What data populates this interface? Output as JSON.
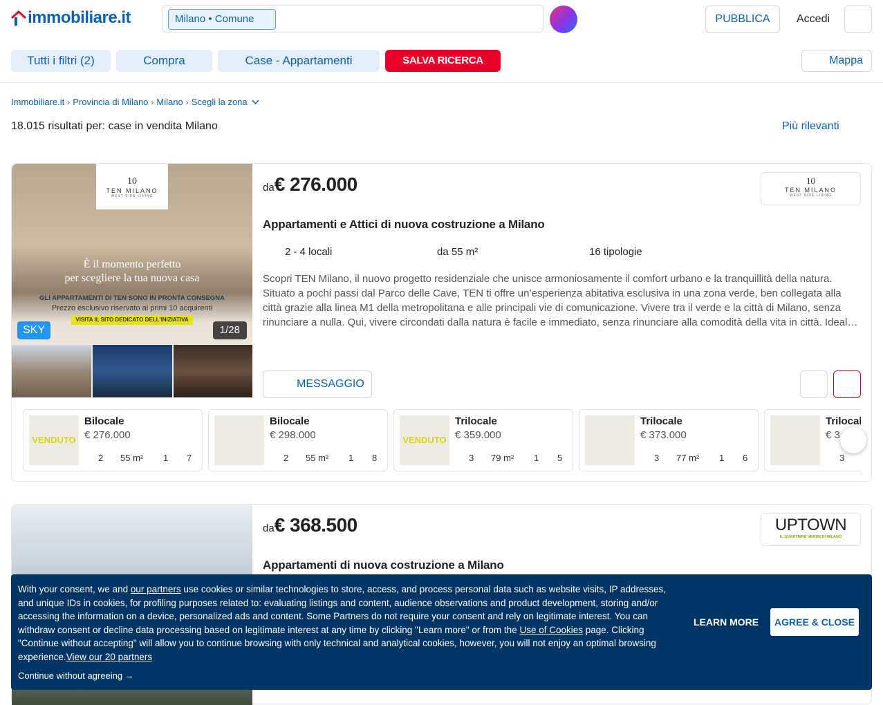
{
  "header": {
    "logo_text": "immobiliare.it",
    "search_chip": "Milano • Comune",
    "publish_label": "PUBBLICA",
    "login_label": "Accedi"
  },
  "filters": {
    "all_filters": "Tutti i filtri (2)",
    "contract": "Compra",
    "category": "Case - Appartamenti",
    "save_search": "SALVA RICERCA",
    "map": "Mappa"
  },
  "breadcrumb": [
    "Immobiliare.it",
    "Provincia di Milano",
    "Milano",
    "Scegli la zona"
  ],
  "results": {
    "summary": "18.015 risultati per: case in vendita Milano",
    "sort_label": "Più rilevanti"
  },
  "listings": [
    {
      "badge": "SKY",
      "photo_count": "1/28",
      "hero_headline_1": "È il momento perfetto",
      "hero_headline_2": "per scegliere la tua nuova casa",
      "hero_banner_1": "GLI APPARTAMENTI DI TEN SONO IN PRONTA CONSEGNA",
      "hero_banner_2": "Prezzo esclusivo riservato ai primi 10 acquirenti",
      "hero_banner_3": "VISITA IL SITO DEDICATO DELL'INIZIATIVA",
      "hero_logo_main": "TEN MILANO",
      "hero_logo_sub": "WEST SIDE LIVING",
      "price_prefix": "da",
      "price": "€ 276.000",
      "brand_logo": "TEN MILANO",
      "brand_logo_sub": "WEST SIDE LIVING",
      "title": "Appartamenti e Attici di nuova costruzione a Milano",
      "rooms": "2 - 4 locali",
      "surface": "da 55 m²",
      "typologies": "16 tipologie",
      "description": "Scopri TEN Milano, il nuovo progetto residenziale che unisce armoniosamente il comfort urbano e la tranquillità della natura. Situato a pochi passi dal Parco delle Cave, TEN ti offre un’esperienza abitativa esclusiva in una zona verde, ben collegata alla città grazie alla linea M1 della metropolitana e alle principali vie di comunicazione. Vivere tra il verde e la città di Milano, senza rinunciare a nulla. Qui, vivere circondati dalla natura è facile e immediato, senza rinunciare alla comodità della vita in città. Ideal…",
      "message_label": "MESSAGGIO",
      "units": [
        {
          "name": "Bilocale",
          "price": "€ 276.000",
          "rooms": "2",
          "area": "55 m²",
          "baths": "1",
          "floor": "7",
          "sold": "VENDUTO"
        },
        {
          "name": "Bilocale",
          "price": "€ 298.000",
          "rooms": "2",
          "area": "55 m²",
          "baths": "1",
          "floor": "8",
          "sold": ""
        },
        {
          "name": "Trilocale",
          "price": "€ 359.000",
          "rooms": "3",
          "area": "79 m²",
          "baths": "1",
          "floor": "5",
          "sold": "VENDUTO"
        },
        {
          "name": "Trilocale",
          "price": "€ 373.000",
          "rooms": "3",
          "area": "77 m²",
          "baths": "1",
          "floor": "6",
          "sold": ""
        },
        {
          "name": "Trilocale",
          "price": "€ 3",
          "rooms": "3",
          "area": "",
          "baths": "",
          "floor": "",
          "sold": ""
        }
      ]
    },
    {
      "price_prefix": "da",
      "price": "€ 368.500",
      "brand_logo": "UPTOWN",
      "brand_logo_sub": "IL QUARTIERE VERDE DI MILANO",
      "title": "Appartamenti di nuova costruzione a Milano"
    }
  ],
  "cookie": {
    "text_1": "With your consent, we and ",
    "partners_link": "our partners",
    "text_2": " use cookies or similar technologies to store, access, and process personal data such as website visits, IP addresses, and unique IDs in cookies, for profiling purposes related to: evaluating listings and content, audience observations and product development, storing and/or accessing the information on a device, personalized ads and content. Some Partners do not require your consent and rely on legitimate interest. You can withdraw consent or decline data processing based on legitimate interest at any time by clicking \"Learn more\" or from the ",
    "cookies_link": "Use of Cookies",
    "text_3": " page. Clicking \"Continue without accepting\" will allow you to continue browsing with only technical and analytical cookies, however, you will not enjoy an optimal browsing experience.",
    "view_partners": "View our 20 partners",
    "continue_label": "Continue without agreeing →",
    "learn_more": "LEARN MORE",
    "agree": "AGREE & CLOSE"
  },
  "colors": {
    "brand_blue": "#0a62b5",
    "save_red": "#e8002a",
    "cookie_bg": "#003566",
    "sky_badge": "#2196f3"
  }
}
